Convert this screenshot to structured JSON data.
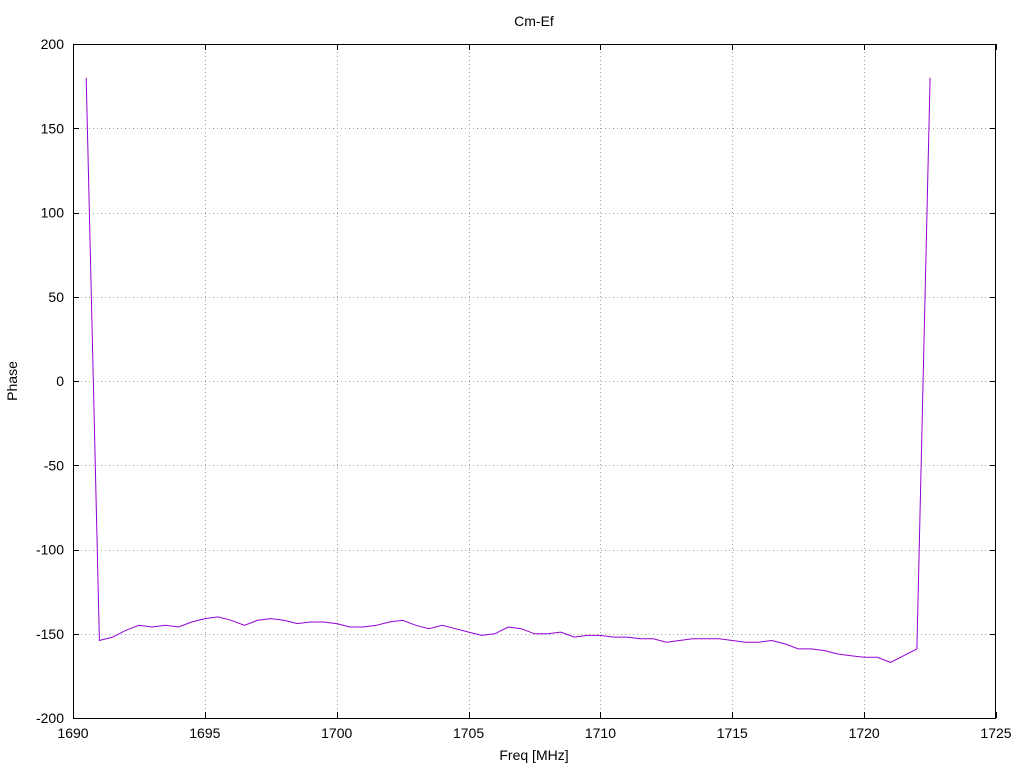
{
  "chart_data": {
    "type": "line",
    "title": "Cm-Ef",
    "xlabel": "Freq [MHz]",
    "ylabel": "Phase",
    "xlim": [
      1690,
      1725
    ],
    "ylim": [
      -200,
      200
    ],
    "xticks": [
      1690,
      1695,
      1700,
      1705,
      1710,
      1715,
      1720,
      1725
    ],
    "yticks": [
      -200,
      -150,
      -100,
      -50,
      0,
      50,
      100,
      150,
      200
    ],
    "grid": true,
    "color": "#9400d3",
    "series": [
      {
        "x": [
          1690.5,
          1691.0,
          1691.5,
          1692.0,
          1692.5,
          1693.0,
          1693.5,
          1694.0,
          1694.5,
          1695.0,
          1695.5,
          1696.0,
          1696.5,
          1697.0,
          1697.5,
          1698.0,
          1698.5,
          1699.0,
          1699.5,
          1700.0,
          1700.5,
          1701.0,
          1701.5,
          1702.0,
          1702.5,
          1703.0,
          1703.5,
          1704.0,
          1704.5,
          1705.0,
          1705.5,
          1706.0,
          1706.5,
          1707.0,
          1707.5,
          1708.0,
          1708.5,
          1709.0,
          1709.5,
          1710.0,
          1710.5,
          1711.0,
          1711.5,
          1712.0,
          1712.5,
          1713.0,
          1713.5,
          1714.0,
          1714.5,
          1715.0,
          1715.5,
          1716.0,
          1716.5,
          1717.0,
          1717.5,
          1718.0,
          1718.5,
          1719.0,
          1719.5,
          1720.0,
          1720.5,
          1721.0,
          1721.5,
          1722.0,
          1722.5
        ],
        "y": [
          180,
          -154,
          -152,
          -148,
          -145,
          -146,
          -145,
          -146,
          -143,
          -141,
          -140,
          -142,
          -145,
          -142,
          -141,
          -142,
          -144,
          -143,
          -143,
          -144,
          -146,
          -146,
          -145,
          -143,
          -142,
          -145,
          -147,
          -145,
          -147,
          -149,
          -151,
          -150,
          -146,
          -147,
          -150,
          -150,
          -149,
          -152,
          -151,
          -151,
          -152,
          -152,
          -153,
          -153,
          -155,
          -154,
          -153,
          -153,
          -153,
          -154,
          -155,
          -155,
          -154,
          -156,
          -159,
          -159,
          -160,
          -162,
          -163,
          -164,
          -164,
          -167,
          -163,
          -159,
          180
        ]
      }
    ]
  }
}
